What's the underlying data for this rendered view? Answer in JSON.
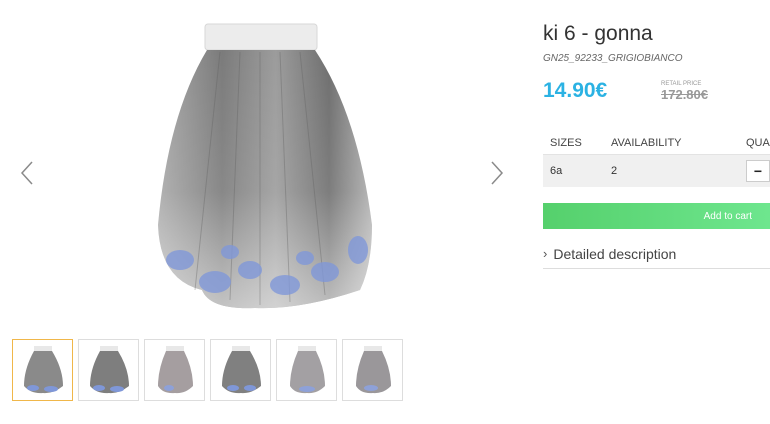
{
  "product": {
    "title": "ki 6 - gonna",
    "sku": "GN25_92233_GRIGIOBIANCO",
    "price": "14.90€",
    "retail_label": "RETAIL PRICE",
    "retail_price": "172.80€"
  },
  "table": {
    "headers": [
      "SIZES",
      "AVAILABILITY",
      "QUANTITY"
    ],
    "rows": [
      {
        "size": "6a",
        "availability": "2",
        "qty_minus": "−"
      }
    ]
  },
  "actions": {
    "add_to_cart": "Add to cart",
    "detailed_description": "Detailed description",
    "desc_chevron": "›"
  },
  "gallery": {
    "thumbnail_count": 6,
    "active_thumbnail": 1
  },
  "colors": {
    "price": "#2bb2e3",
    "cart_button": "#5bd874",
    "active_thumb_border": "#f0b74a"
  }
}
